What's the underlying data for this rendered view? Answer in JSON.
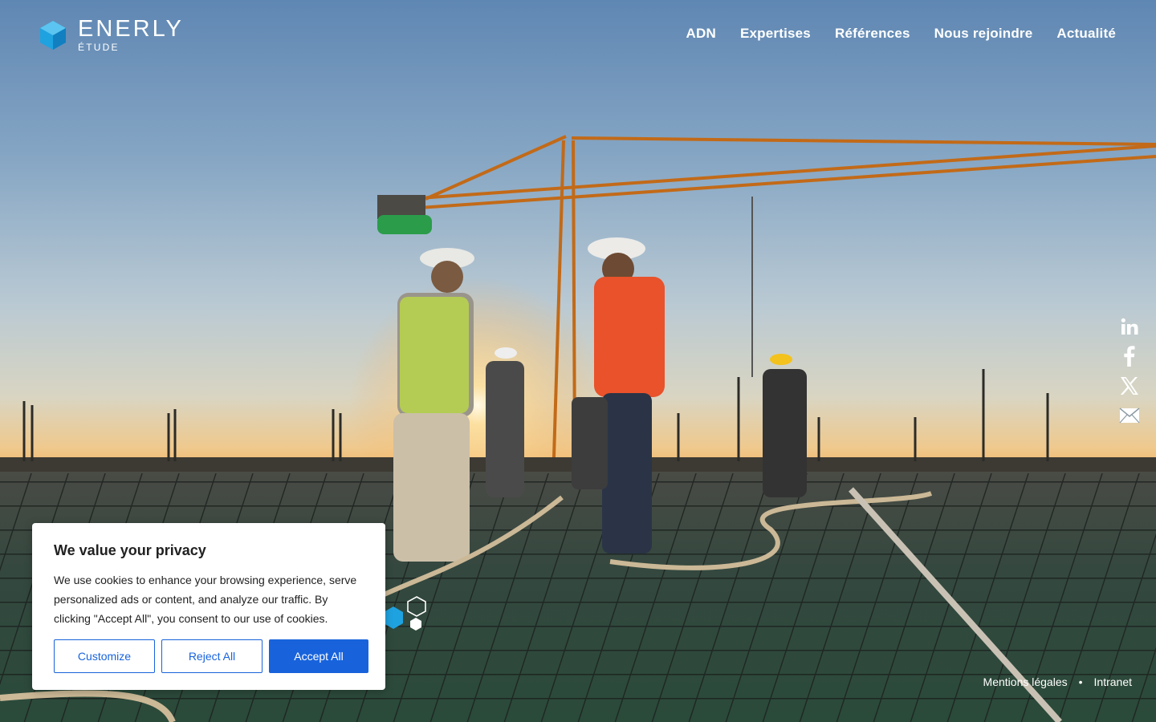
{
  "brand": {
    "name": "ENERLY",
    "sub": "ÉTUDE",
    "logo_icon": "enerly-hex-logo-icon",
    "accent": "#1fa2e0"
  },
  "nav": {
    "items": [
      {
        "label": "ADN"
      },
      {
        "label": "Expertises"
      },
      {
        "label": "Références"
      },
      {
        "label": "Nous rejoindre"
      },
      {
        "label": "Actualité"
      }
    ]
  },
  "social": [
    {
      "icon": "linkedin-icon"
    },
    {
      "icon": "facebook-icon"
    },
    {
      "icon": "x-twitter-icon"
    },
    {
      "icon": "mail-icon"
    }
  ],
  "footer": {
    "legal": "Mentions légales",
    "separator": "•",
    "intranet": "Intranet"
  },
  "cookie": {
    "title": "We value your privacy",
    "text": "We use cookies to enhance your browsing experience, serve personalized ads or content, and analyze our traffic. By clicking \"Accept All\", you consent to our use of cookies.",
    "customize": "Customize",
    "reject": "Reject All",
    "accept": "Accept All",
    "button_color": "#1863dc"
  }
}
